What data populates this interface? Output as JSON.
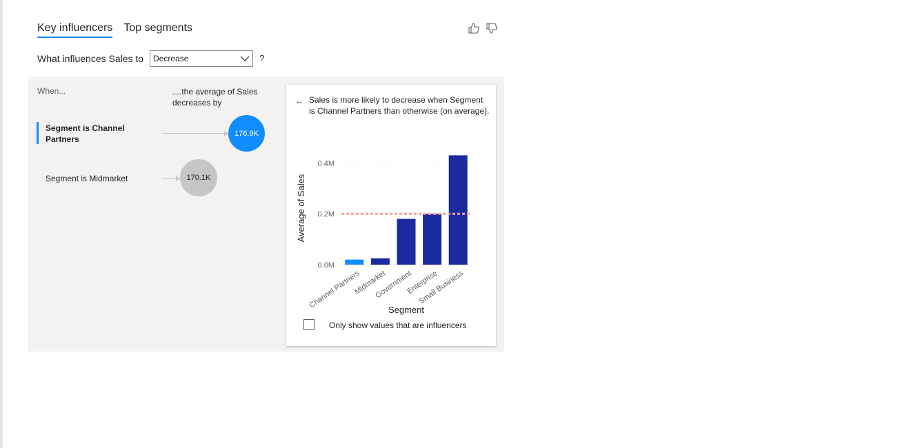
{
  "tabs": [
    {
      "label": "Key influencers",
      "active": true
    },
    {
      "label": "Top segments",
      "active": false
    }
  ],
  "feedback": {
    "thumbs_up": "thumbs-up-icon",
    "thumbs_down": "thumbs-down-icon"
  },
  "question": {
    "prefix": "What influences Sales to",
    "selected": "Decrease",
    "suffix": "?"
  },
  "influencers": {
    "when_header": "When...",
    "avg_header": "....the average of Sales decreases by",
    "items": [
      {
        "label": "Segment is Channel Partners",
        "value": "176.9K",
        "selected": true
      },
      {
        "label": "Segment is Midmarket",
        "value": "170.1K",
        "selected": false
      }
    ]
  },
  "detail": {
    "description": "Sales is more likely to decrease when Segment is Channel Partners than otherwise (on average).",
    "checkbox_label": "Only show values that are influencers",
    "checkbox_checked": false
  },
  "chart_data": {
    "type": "bar",
    "categories": [
      "Channel Partners",
      "Midmarket",
      "Government",
      "Enterprise",
      "Small Business"
    ],
    "values": [
      0.02,
      0.025,
      0.18,
      0.2,
      0.43
    ],
    "highlight_index": 0,
    "reference_line": 0.2,
    "xlabel": "Segment",
    "ylabel": "Average of Sales",
    "ylim": [
      0,
      0.45
    ],
    "yticks": [
      {
        "value": 0,
        "label": "0.0M"
      },
      {
        "value": 0.2,
        "label": "0.2M"
      },
      {
        "value": 0.4,
        "label": "0.4M"
      }
    ],
    "colors": {
      "bar": "#1c2aa0",
      "highlight": "#118dff",
      "reference": "#f4a3a0",
      "grid": "#d0d0d0"
    }
  }
}
